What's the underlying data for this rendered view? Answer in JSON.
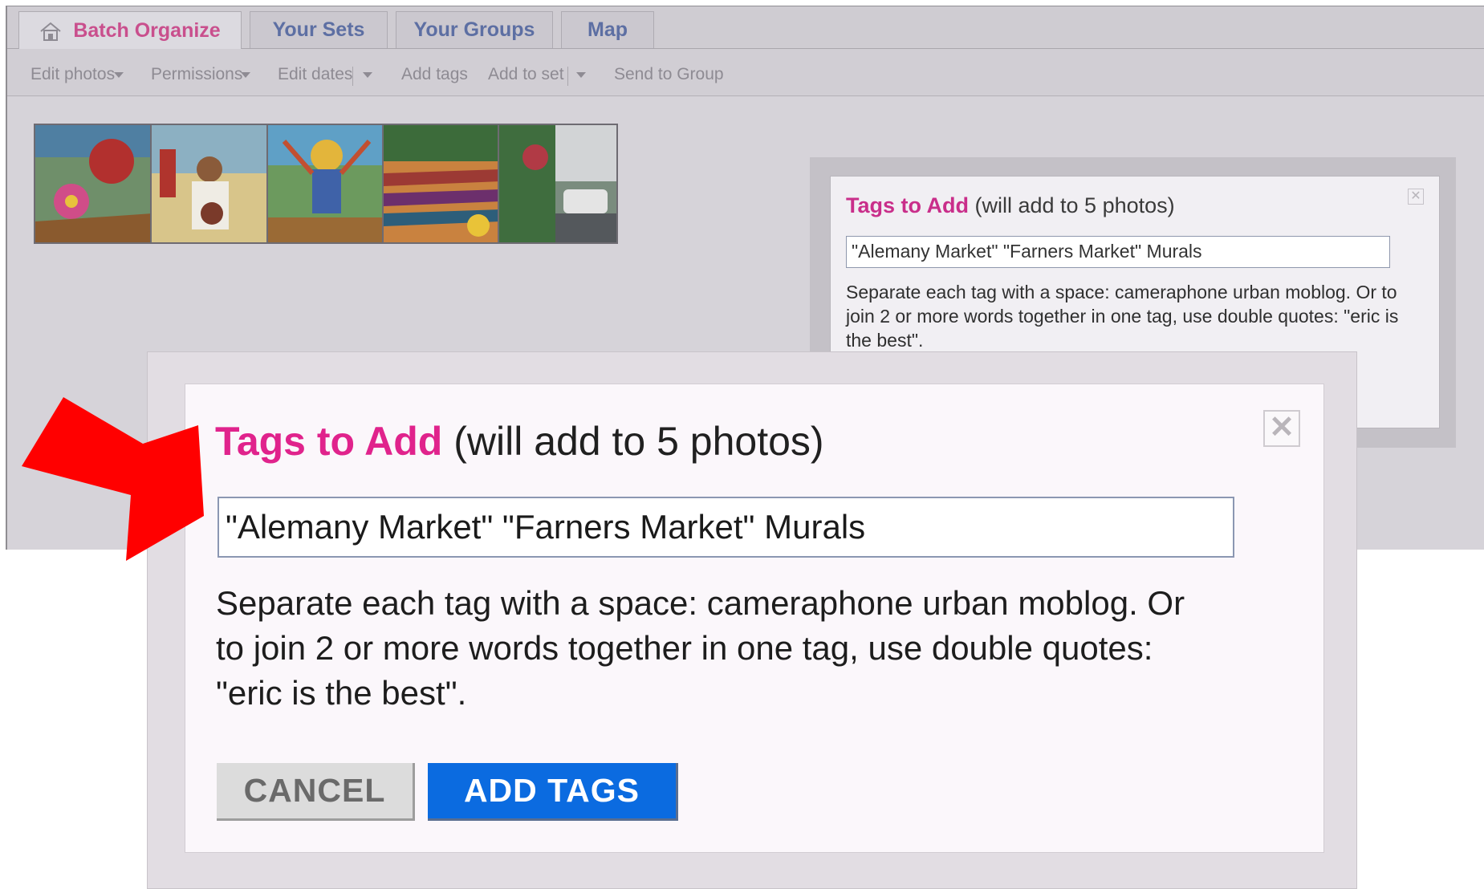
{
  "tabs": [
    {
      "label": "Batch Organize",
      "active": true
    },
    {
      "label": "Your Sets"
    },
    {
      "label": "Your Groups"
    },
    {
      "label": "Map"
    }
  ],
  "toolbar": {
    "edit_photos": "Edit photos",
    "permissions": "Permissions",
    "edit_dates": "Edit dates",
    "add_tags": "Add tags",
    "add_to_set": "Add to set",
    "send_to_group": "Send to Group"
  },
  "selected_photo_count": 5,
  "small_dialog": {
    "title": "Tags to Add",
    "subtitle": "(will add to 5 photos)",
    "input_value": "\"Alemany Market\" \"Farners Market\" Murals",
    "help_text": "Separate each tag with a space: cameraphone urban moblog. Or to join 2 or more words together in one tag, use double quotes: \"eric is the best\"."
  },
  "dialog": {
    "title": "Tags to Add",
    "subtitle": "(will add to 5 photos)",
    "input_value": "\"Alemany Market\" \"Farners Market\" Murals",
    "help_line1": "Separate each tag with a space: cameraphone urban moblog. Or",
    "help_line2": "to join 2 or more words together in one tag, use double quotes:",
    "help_line3": "\"eric is the best\".",
    "cancel_label": "CANCEL",
    "add_label": "ADD TAGS"
  },
  "colors": {
    "accent_pink": "#e0238c",
    "button_blue": "#0b6be0",
    "arrow_red": "#ff0000"
  },
  "icons": [
    "home-icon",
    "caret-down-icon",
    "close-icon",
    "red-arrow-icon"
  ]
}
